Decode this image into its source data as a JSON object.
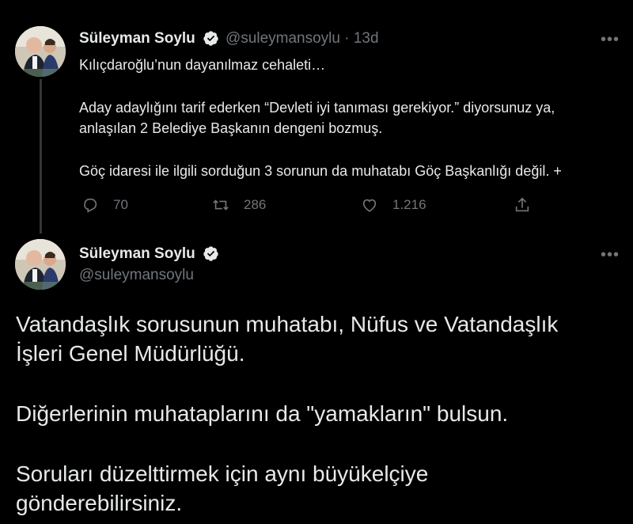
{
  "tweet1": {
    "author_name": "Süleyman Soylu",
    "author_handle": "@suleymansoylu · 13d",
    "more_label": "•••",
    "lines": [
      "Kılıçdaroğlu’nun dayanılmaz cehaleti…",
      "Aday adaylığını tarif ederken “Devleti iyi tanıması gerekiyor.” diyorsunuz ya,",
      "anlaşılan 2 Belediye Başkanın dengeni bozmuş.",
      "Göç idaresi ile ilgili sorduğun 3 sorunun da muhatabı Göç Başkanlığı değil. +"
    ],
    "actions": {
      "reply_count": "70",
      "retweet_count": "286",
      "like_count": "1.216"
    },
    "icons": [
      "reply-icon",
      "retweet-icon",
      "like-icon",
      "share-icon",
      "verified-icon"
    ]
  },
  "tweet2": {
    "author_name": "Süleyman Soylu",
    "author_handle": "@suleymansoylu",
    "more_label": "•••",
    "lines": [
      "Vatandaşlık sorusunun muhatabı, Nüfus ve Vatandaşlık",
      "İşleri Genel Müdürlüğü.",
      "Diğerlerinin muhataplarını da  \"yamakların\" bulsun.",
      "Soruları düzelttirmek için aynı büyükelçiye",
      "gönderebilirsiniz."
    ]
  },
  "colors": {
    "background": "#000000",
    "text": "#e7e9ea",
    "secondary": "#71767b",
    "thread_line": "#333639"
  }
}
